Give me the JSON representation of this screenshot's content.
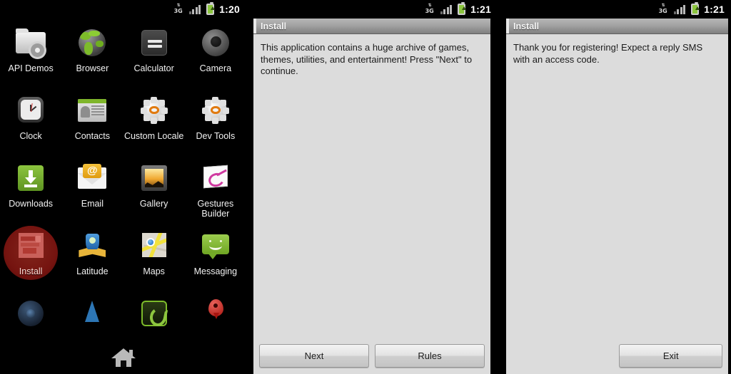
{
  "launcher": {
    "statusbar": {
      "network_label": "3G",
      "network_icon": "3g-data-icon",
      "signal_icon": "signal-bars-icon",
      "battery_icon": "battery-charging-icon",
      "time": "1:20"
    },
    "apps": [
      {
        "label": "API Demos",
        "icon": "api-demos-icon",
        "selected": false
      },
      {
        "label": "Browser",
        "icon": "browser-globe-icon",
        "selected": false
      },
      {
        "label": "Calculator",
        "icon": "calculator-icon",
        "selected": false
      },
      {
        "label": "Camera",
        "icon": "camera-icon",
        "selected": false
      },
      {
        "label": "Clock",
        "icon": "clock-icon",
        "selected": false
      },
      {
        "label": "Contacts",
        "icon": "contacts-icon",
        "selected": false
      },
      {
        "label": "Custom Locale",
        "icon": "custom-locale-gear-icon",
        "selected": false
      },
      {
        "label": "Dev Tools",
        "icon": "dev-tools-gear-icon",
        "selected": false
      },
      {
        "label": "Downloads",
        "icon": "downloads-icon",
        "selected": false
      },
      {
        "label": "Email",
        "icon": "email-icon",
        "selected": false
      },
      {
        "label": "Gallery",
        "icon": "gallery-icon",
        "selected": false
      },
      {
        "label": "Gestures Builder",
        "icon": "gestures-builder-icon",
        "selected": false
      },
      {
        "label": "Install",
        "icon": "install-app-icon",
        "selected": true
      },
      {
        "label": "Latitude",
        "icon": "latitude-icon",
        "selected": false
      },
      {
        "label": "Maps",
        "icon": "maps-icon",
        "selected": false
      },
      {
        "label": "Messaging",
        "icon": "messaging-icon",
        "selected": false
      }
    ],
    "partial_apps": [
      {
        "label": "",
        "icon": "music-icon"
      },
      {
        "label": "",
        "icon": "navigation-icon"
      },
      {
        "label": "",
        "icon": "phone-icon"
      },
      {
        "label": "",
        "icon": "places-pin-icon"
      }
    ],
    "home_button": {
      "icon": "home-icon"
    },
    "selection_color": "#a8221b"
  },
  "panel_install_step1": {
    "statusbar": {
      "network_label": "3G",
      "time": "1:21"
    },
    "title": "Install",
    "body": "This application contains a huge archive of games, themes, utilities, and entertainment! Press \"Next\" to continue.",
    "buttons": [
      {
        "label": "Next",
        "name": "next-button"
      },
      {
        "label": "Rules",
        "name": "rules-button"
      }
    ]
  },
  "panel_install_step2": {
    "statusbar": {
      "network_label": "3G",
      "time": "1:21"
    },
    "title": "Install",
    "body": "Thank you for registering! Expect a reply SMS with an access code.",
    "buttons": [
      {
        "label": "Exit",
        "name": "exit-button"
      }
    ]
  },
  "theme": {
    "window_bg": "#dcdcdc",
    "title_bg": "#a3a3a3",
    "text_color": "#1b1b1b",
    "desktop_bg": "#000000"
  }
}
